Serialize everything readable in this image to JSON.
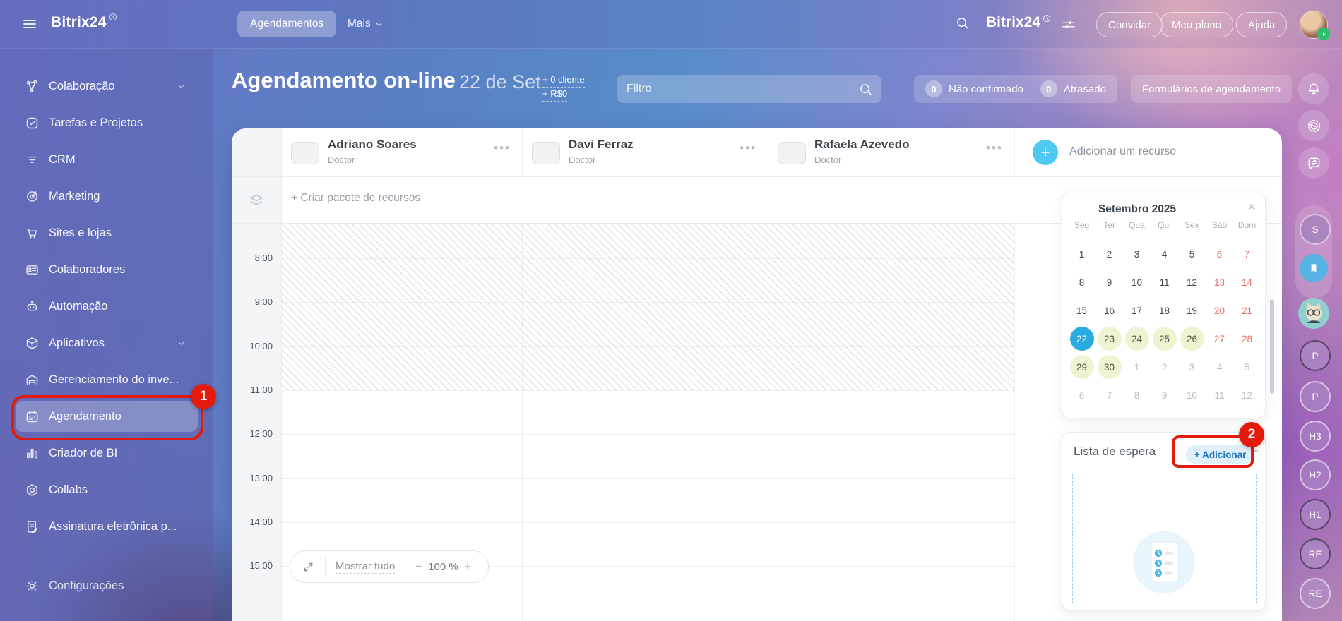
{
  "theme": {
    "accent_blue": "#2aace2",
    "annotation_red": "#e41b0c",
    "weekend_red": "#e86c60",
    "highlight_green": "#eef3d2",
    "resource_plus_blue": "#4fc8f2"
  },
  "topbar": {
    "logo": "Bitrix24",
    "tabs": [
      {
        "label": "Agendamentos",
        "active": true
      },
      {
        "label": "Mais",
        "chevron": true
      }
    ],
    "header_logo": "Bitrix24",
    "buttons": [
      {
        "label": "Convidar"
      },
      {
        "label": "Meu plano"
      },
      {
        "label": "Ajuda"
      }
    ]
  },
  "sidebar": {
    "items": [
      {
        "label": "Colaboração",
        "icon": "network",
        "chevron": true
      },
      {
        "label": "Tarefas e Projetos",
        "icon": "task"
      },
      {
        "label": "CRM",
        "icon": "crm"
      },
      {
        "label": "Marketing",
        "icon": "marketing"
      },
      {
        "label": "Sites e lojas",
        "icon": "cart"
      },
      {
        "label": "Colaboradores",
        "icon": "idcard"
      },
      {
        "label": "Automação",
        "icon": "robot"
      },
      {
        "label": "Aplicativos",
        "icon": "box",
        "chevron": true
      },
      {
        "label": "Gerenciamento do inve...",
        "icon": "warehouse"
      },
      {
        "label": "Agendamento",
        "icon": "calendar",
        "active": true
      },
      {
        "label": "Criador de BI",
        "icon": "chart"
      },
      {
        "label": "Collabs",
        "icon": "hexagon"
      },
      {
        "label": "Assinatura eletrônica p...",
        "icon": "signature"
      },
      {
        "label": "Configurações",
        "icon": "gear",
        "gap": true
      }
    ]
  },
  "page": {
    "title": "Agendamento on-line",
    "date": "22 de Set",
    "client_count": "+ 0 cliente",
    "amount": "+ R$0",
    "filter_placeholder": "Filtro",
    "counters": [
      {
        "count": "0",
        "label": "Não confirmado"
      },
      {
        "count": "0",
        "label": "Atrasado"
      }
    ],
    "forms_button": "Formulários de agendamento"
  },
  "board": {
    "resources": [
      {
        "name": "Adriano Soares",
        "role": "Doctor"
      },
      {
        "name": "Davi Ferraz",
        "role": "Doctor"
      },
      {
        "name": "Rafaela Azevedo",
        "role": "Doctor"
      }
    ],
    "add_resource": "Adicionar um recurso",
    "create_package": "+ Criar pacote de recursos",
    "times": [
      "8:00",
      "9:00",
      "10:00",
      "11:00",
      "12:00",
      "13:00",
      "14:00",
      "15:00"
    ],
    "show_all": "Mostrar tudo",
    "zoom_out": "−",
    "zoom_value": "100 %",
    "zoom_in": "+"
  },
  "calendar": {
    "title": "Setembro 2025",
    "weekdays": [
      "Seg",
      "Ter",
      "Qua",
      "Qui",
      "Sex",
      "Sáb",
      "Dom"
    ],
    "days": [
      {
        "d": "1"
      },
      {
        "d": "2"
      },
      {
        "d": "3"
      },
      {
        "d": "4"
      },
      {
        "d": "5"
      },
      {
        "d": "6",
        "s": "we"
      },
      {
        "d": "7",
        "s": "we"
      },
      {
        "d": "8"
      },
      {
        "d": "9"
      },
      {
        "d": "10"
      },
      {
        "d": "11"
      },
      {
        "d": "12"
      },
      {
        "d": "13",
        "s": "we"
      },
      {
        "d": "14",
        "s": "we"
      },
      {
        "d": "15"
      },
      {
        "d": "16"
      },
      {
        "d": "17"
      },
      {
        "d": "18"
      },
      {
        "d": "19"
      },
      {
        "d": "20",
        "s": "we"
      },
      {
        "d": "21",
        "s": "we"
      },
      {
        "d": "22",
        "s": "sel"
      },
      {
        "d": "23",
        "s": "hl"
      },
      {
        "d": "24",
        "s": "hl"
      },
      {
        "d": "25",
        "s": "hl"
      },
      {
        "d": "26",
        "s": "hl"
      },
      {
        "d": "27",
        "s": "we"
      },
      {
        "d": "28",
        "s": "we"
      },
      {
        "d": "29",
        "s": "hl"
      },
      {
        "d": "30",
        "s": "hl"
      },
      {
        "d": "1",
        "s": "mut"
      },
      {
        "d": "2",
        "s": "mut"
      },
      {
        "d": "3",
        "s": "mut"
      },
      {
        "d": "4",
        "s": "mut"
      },
      {
        "d": "5",
        "s": "mut"
      },
      {
        "d": "6",
        "s": "mut"
      },
      {
        "d": "7",
        "s": "mut"
      },
      {
        "d": "8",
        "s": "mut"
      },
      {
        "d": "9",
        "s": "mut"
      },
      {
        "d": "10",
        "s": "mut"
      },
      {
        "d": "11",
        "s": "mut"
      },
      {
        "d": "12",
        "s": "mut"
      }
    ]
  },
  "waitlist": {
    "title": "Lista de espera",
    "add_button": "+ Adicionar"
  },
  "right_rail": {
    "icons": [
      "bell",
      "copilot",
      "chat-sync"
    ],
    "pinned_initial": "S",
    "avatars": [
      {
        "label": "P",
        "dark": true
      },
      {
        "label": "P"
      },
      {
        "label": "H3"
      },
      {
        "label": "H2"
      },
      {
        "label": "H1",
        "dark": true
      },
      {
        "label": "RE",
        "dark": true
      },
      {
        "label": "RE"
      }
    ]
  },
  "annotations": {
    "step1": "1",
    "step2": "2"
  }
}
